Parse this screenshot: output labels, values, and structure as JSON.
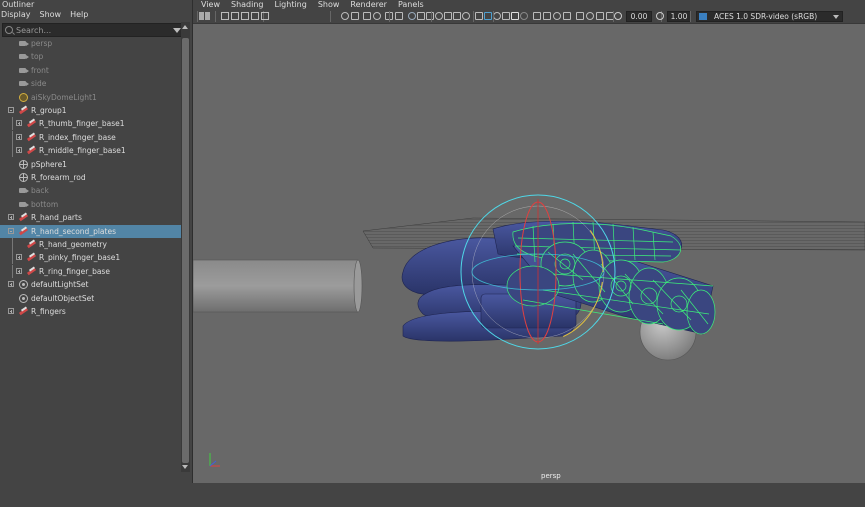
{
  "outliner": {
    "title": "Outliner",
    "menu": [
      "Display",
      "Show",
      "Help"
    ],
    "search_placeholder": "Search...",
    "items": [
      {
        "label": "persp",
        "icon": "camera-icon",
        "dim": true,
        "indent": 1
      },
      {
        "label": "top",
        "icon": "camera-icon",
        "dim": true,
        "indent": 1
      },
      {
        "label": "front",
        "icon": "camera-icon",
        "dim": true,
        "indent": 1
      },
      {
        "label": "side",
        "icon": "camera-icon",
        "dim": true,
        "indent": 1
      },
      {
        "label": "aiSkyDomeLight1",
        "icon": "light-icon",
        "dim": true,
        "indent": 1
      },
      {
        "label": "R_group1",
        "icon": "group-icon",
        "expander": "minus",
        "indent": 0
      },
      {
        "label": "R_thumb_finger_base1",
        "icon": "group-icon",
        "expander": "plus",
        "indent": 2
      },
      {
        "label": "R_index_finger_base",
        "icon": "group-icon",
        "expander": "plus",
        "indent": 2
      },
      {
        "label": "R_middle_finger_base1",
        "icon": "group-icon",
        "expander": "plus",
        "indent": 2
      },
      {
        "label": "pSphere1",
        "icon": "mesh-icon",
        "indent": 1
      },
      {
        "label": "R_forearm_rod",
        "icon": "mesh-icon",
        "indent": 1
      },
      {
        "label": "back",
        "icon": "camera-icon",
        "dim": true,
        "indent": 1
      },
      {
        "label": "bottom",
        "icon": "camera-icon",
        "dim": true,
        "indent": 1
      },
      {
        "label": "R_hand_parts",
        "icon": "group-icon",
        "expander": "plus",
        "indent": 0
      },
      {
        "label": "R_hand_second_plates",
        "icon": "group-icon",
        "expander": "minus",
        "indent": 0,
        "selected": true
      },
      {
        "label": "R_hand_geometry",
        "icon": "group-icon",
        "indent": 2
      },
      {
        "label": "R_pinky_finger_base1",
        "icon": "group-icon",
        "expander": "plus",
        "indent": 2
      },
      {
        "label": "R_ring_finger_base",
        "icon": "group-icon",
        "expander": "plus",
        "indent": 2
      },
      {
        "label": "defaultLightSet",
        "icon": "set-icon",
        "expander": "plus",
        "indent": 0
      },
      {
        "label": "defaultObjectSet",
        "icon": "set-icon",
        "indent": 1
      },
      {
        "label": "R_fingers",
        "icon": "group-icon",
        "expander": "plus",
        "indent": 0
      }
    ]
  },
  "viewport": {
    "menu": [
      "View",
      "Shading",
      "Lighting",
      "Show",
      "Renderer",
      "Panels"
    ],
    "exposure": "0.00",
    "gamma": "1.00",
    "color_space": "ACES 1.0 SDR-video (sRGB)",
    "camera_label": "persp"
  },
  "colors": {
    "selection": "#5285a6",
    "hand_mesh": "#3a4680",
    "wireframe_selected": "#3df07a",
    "manipulator_cyan": "#4fd8e8"
  }
}
